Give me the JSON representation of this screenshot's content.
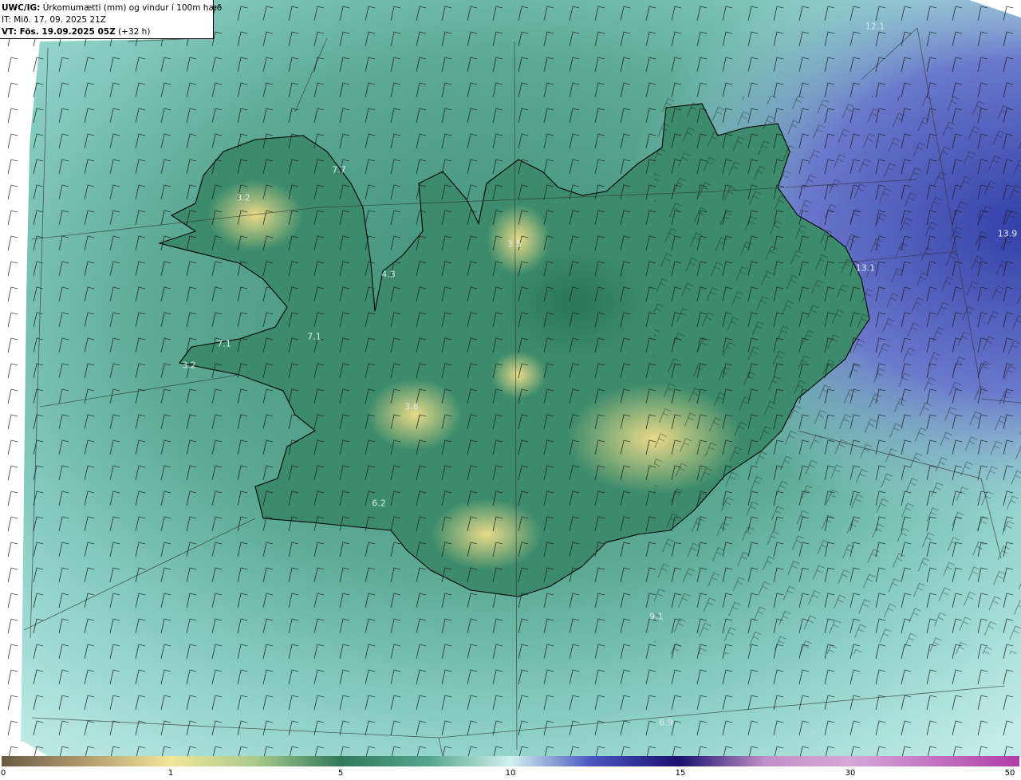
{
  "header": {
    "model_label": "UWC/IG:",
    "product": "Úrkomumætti (mm) og vindur í 100m hæð",
    "initial_time": "IT: Mið. 17. 09. 2025 21Z",
    "valid_label": "VT: Fös. 19.09.2025 05Z",
    "valid_offset": "(+32 h)"
  },
  "map_labels": [
    {
      "text": "3.2"
    },
    {
      "text": "7.7"
    },
    {
      "text": "4.3"
    },
    {
      "text": "3.5"
    },
    {
      "text": "7.1"
    },
    {
      "text": "3.2"
    },
    {
      "text": "7.1"
    },
    {
      "text": "3.6"
    },
    {
      "text": "6.2"
    },
    {
      "text": "12.1"
    },
    {
      "text": "13.9"
    },
    {
      "text": "13.1"
    },
    {
      "text": "9.1"
    },
    {
      "text": "6.9"
    }
  ],
  "colorbar": {
    "ticks": [
      "0",
      "1",
      "5",
      "10",
      "15",
      "30",
      "50"
    ],
    "colors": [
      "#6b5a42",
      "#b09a6c",
      "#f2e699",
      "#a8c98a",
      "#2f7a5a",
      "#55a68f",
      "#a6e0db",
      "#d2f0f0",
      "#4a55c0",
      "#1a1070",
      "#d5a8d8",
      "#b03da8"
    ]
  },
  "map_colors": {
    "sea_near": "#4f9f8d",
    "sea_far": "#a8e0dd",
    "east_high": "#3e52b8",
    "land_low": "#3a8a6a",
    "land_dry": "#d8d07c",
    "coast": "#000000"
  }
}
